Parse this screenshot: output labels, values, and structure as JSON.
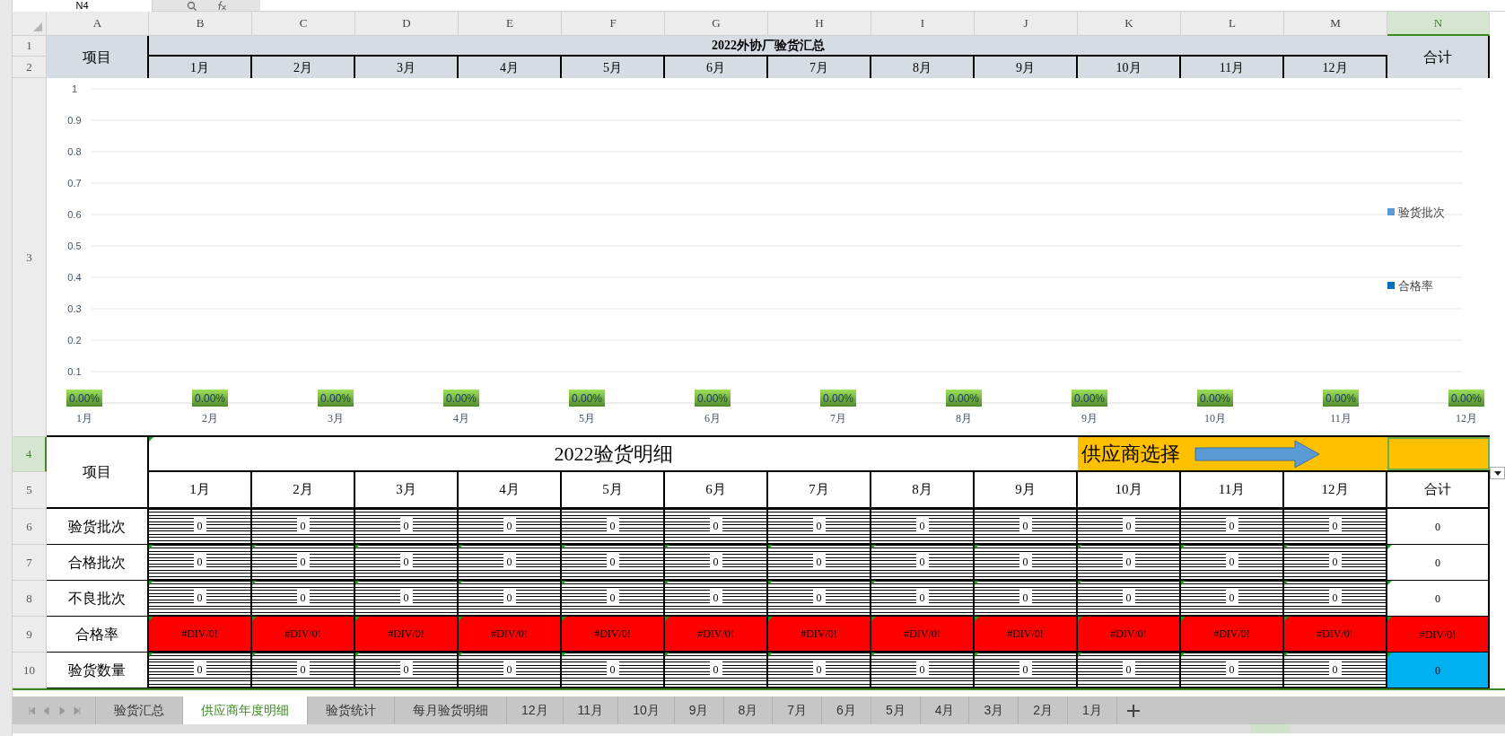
{
  "formula_bar": {
    "cell_ref": "N4"
  },
  "column_headers": [
    {
      "label": "A",
      "selected": false
    },
    {
      "label": "B",
      "selected": false
    },
    {
      "label": "C",
      "selected": false
    },
    {
      "label": "D",
      "selected": false
    },
    {
      "label": "E",
      "selected": false
    },
    {
      "label": "F",
      "selected": false
    },
    {
      "label": "G",
      "selected": false
    },
    {
      "label": "H",
      "selected": false
    },
    {
      "label": "I",
      "selected": false
    },
    {
      "label": "J",
      "selected": false
    },
    {
      "label": "K",
      "selected": false
    },
    {
      "label": "L",
      "selected": false
    },
    {
      "label": "M",
      "selected": false
    },
    {
      "label": "N",
      "selected": true
    }
  ],
  "row_headers": [
    {
      "label": "1",
      "selected": false
    },
    {
      "label": "2",
      "selected": false
    },
    {
      "label": "3",
      "selected": false
    },
    {
      "label": "4",
      "selected": true
    },
    {
      "label": "5",
      "selected": false
    },
    {
      "label": "6",
      "selected": false
    },
    {
      "label": "7",
      "selected": false
    },
    {
      "label": "8",
      "selected": false
    },
    {
      "label": "9",
      "selected": false
    },
    {
      "label": "10",
      "selected": false
    }
  ],
  "summary": {
    "item_header": "项目",
    "title": "2022外协厂验货汇总",
    "months": [
      "1月",
      "2月",
      "3月",
      "4月",
      "5月",
      "6月",
      "7月",
      "8月",
      "9月",
      "10月",
      "11月",
      "12月"
    ],
    "total_header": "合计",
    "chart_data": {
      "type": "bar",
      "categories": [
        "1月",
        "2月",
        "3月",
        "4月",
        "5月",
        "6月",
        "7月",
        "8月",
        "9月",
        "10月",
        "11月",
        "12月"
      ],
      "series": [
        {
          "name": "验货批次",
          "color": "#5b9bd5",
          "values": [
            0,
            0,
            0,
            0,
            0,
            0,
            0,
            0,
            0,
            0,
            0,
            0
          ]
        },
        {
          "name": "合格率",
          "color": "#0070c0",
          "values": [
            0,
            0,
            0,
            0,
            0,
            0,
            0,
            0,
            0,
            0,
            0,
            0
          ]
        }
      ],
      "grid": true,
      "ylim": [
        0,
        1
      ],
      "yticks": [
        0.1,
        0.2,
        0.3,
        0.4,
        0.5,
        0.6,
        0.7,
        0.8,
        0.9,
        1
      ],
      "value_labels": [
        "0.00%",
        "0.00%",
        "0.00%",
        "0.00%",
        "0.00%",
        "0.00%",
        "0.00%",
        "0.00%",
        "0.00%",
        "0.00%",
        "0.00%",
        "0.00%"
      ]
    }
  },
  "detail": {
    "title": "2022验货明细",
    "supplier_label": "供应商选择",
    "item_header": "项目",
    "months": [
      "1月",
      "2月",
      "3月",
      "4月",
      "5月",
      "6月",
      "7月",
      "8月",
      "9月",
      "10月",
      "11月",
      "12月"
    ],
    "total_header": "合计",
    "rows": [
      {
        "label": "验货批次",
        "kind": "count",
        "cells": [
          "0",
          "0",
          "0",
          "0",
          "0",
          "0",
          "0",
          "0",
          "0",
          "0",
          "0",
          "0"
        ],
        "total": "0"
      },
      {
        "label": "合格批次",
        "kind": "count",
        "cells": [
          "0",
          "0",
          "0",
          "0",
          "0",
          "0",
          "0",
          "0",
          "0",
          "0",
          "0",
          "0"
        ],
        "total": "0"
      },
      {
        "label": "不良批次",
        "kind": "count",
        "cells": [
          "0",
          "0",
          "0",
          "0",
          "0",
          "0",
          "0",
          "0",
          "0",
          "0",
          "0",
          "0"
        ],
        "total": "0"
      },
      {
        "label": "合格率",
        "kind": "rate",
        "cells": [
          "#DIV/0!",
          "#DIV/0!",
          "#DIV/0!",
          "#DIV/0!",
          "#DIV/0!",
          "#DIV/0!",
          "#DIV/0!",
          "#DIV/0!",
          "#DIV/0!",
          "#DIV/0!",
          "#DIV/0!",
          "#DIV/0!"
        ],
        "total": "#DIV/0!"
      },
      {
        "label": "验货数量",
        "kind": "quantity",
        "cells": [
          "0",
          "0",
          "0",
          "0",
          "0",
          "0",
          "0",
          "0",
          "0",
          "0",
          "0",
          "0"
        ],
        "total": "0"
      }
    ]
  },
  "sheet_tabs": [
    {
      "label": "验货汇总",
      "selected": false
    },
    {
      "label": "供应商年度明细",
      "selected": true
    },
    {
      "label": "验货统计",
      "selected": false
    },
    {
      "label": "每月验货明细",
      "selected": false
    },
    {
      "label": "12月",
      "selected": false
    },
    {
      "label": "11月",
      "selected": false
    },
    {
      "label": "10月",
      "selected": false
    },
    {
      "label": "9月",
      "selected": false
    },
    {
      "label": "8月",
      "selected": false
    },
    {
      "label": "7月",
      "selected": false
    },
    {
      "label": "6月",
      "selected": false
    },
    {
      "label": "5月",
      "selected": false
    },
    {
      "label": "4月",
      "selected": false
    },
    {
      "label": "3月",
      "selected": false
    },
    {
      "label": "2月",
      "selected": false
    },
    {
      "label": "1月",
      "selected": false
    }
  ]
}
